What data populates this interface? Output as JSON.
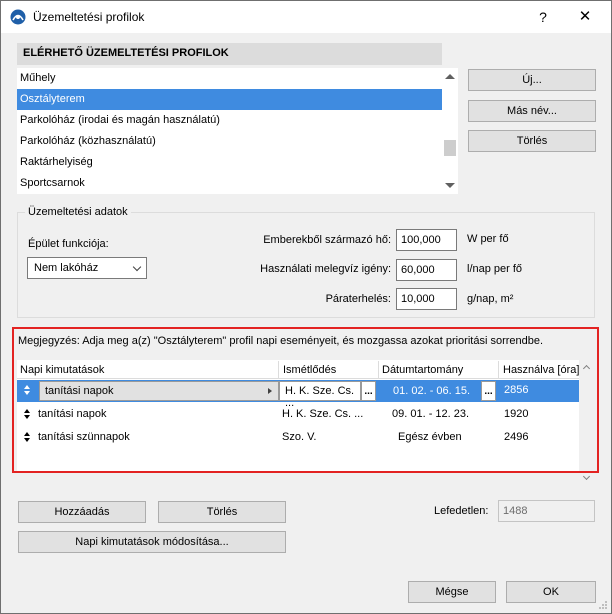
{
  "window": {
    "title": "Üzemeltetési profilok",
    "help": "?",
    "close": "✕"
  },
  "profiles": {
    "header": "ELÉRHETŐ ÜZEMELTETÉSI PROFILOK",
    "items": [
      "Műhely",
      "Osztályterem",
      "Parkolóház (irodai és magán használatú)",
      "Parkolóház (közhasználatú)",
      "Raktárhelyiség",
      "Sportcsarnok"
    ],
    "selected_index": 1,
    "new_button": "Új...",
    "rename_button": "Más név...",
    "delete_button": "Törlés"
  },
  "operation": {
    "group_title": "Üzemeltetési adatok",
    "function_label": "Épület funkciója:",
    "function_value": "Nem lakóház",
    "people_label": "Emberekből származó hő:",
    "people_value": "100,000",
    "people_unit": "W per fő",
    "hotwater_label": "Használati melegvíz igény:",
    "hotwater_value": "60,000",
    "hotwater_unit": "l/nap per fő",
    "humidity_label": "Páraterhelés:",
    "humidity_value": "10,000",
    "humidity_unit": "g/nap, m²"
  },
  "schedule": {
    "note": "Megjegyzés: Adja meg a(z) \"Osztályterem\" profil napi eseményeit, és mozgassa azokat prioritási sorrendbe.",
    "columns": [
      "Napi kimutatások",
      "Ismétlődés",
      "Dátumtartomány",
      "Használva [óra]"
    ],
    "rows": [
      {
        "name": "tanítási napok",
        "repeat": "H. K. Sze. Cs. ...",
        "range": "01. 02. -  06. 15.",
        "hours": "2856"
      },
      {
        "name": "tanítási napok",
        "repeat": "H. K. Sze. Cs. ...",
        "range": "09. 01. -  12. 23.",
        "hours": "1920"
      },
      {
        "name": "tanítási szünnapok",
        "repeat": "Szo. V.",
        "range": "Egész évben",
        "hours": "2496"
      }
    ],
    "dots": "...",
    "add_button": "Hozzáadás",
    "delete_button": "Törlés",
    "uncovered_label": "Lefedetlen:",
    "uncovered_value": "1488",
    "modify_button": "Napi kimutatások módosítása..."
  },
  "footer": {
    "cancel_button": "Mégse",
    "ok_button": "OK"
  },
  "colors": {
    "selection": "#3f8be0",
    "highlight_frame": "#e32322"
  }
}
